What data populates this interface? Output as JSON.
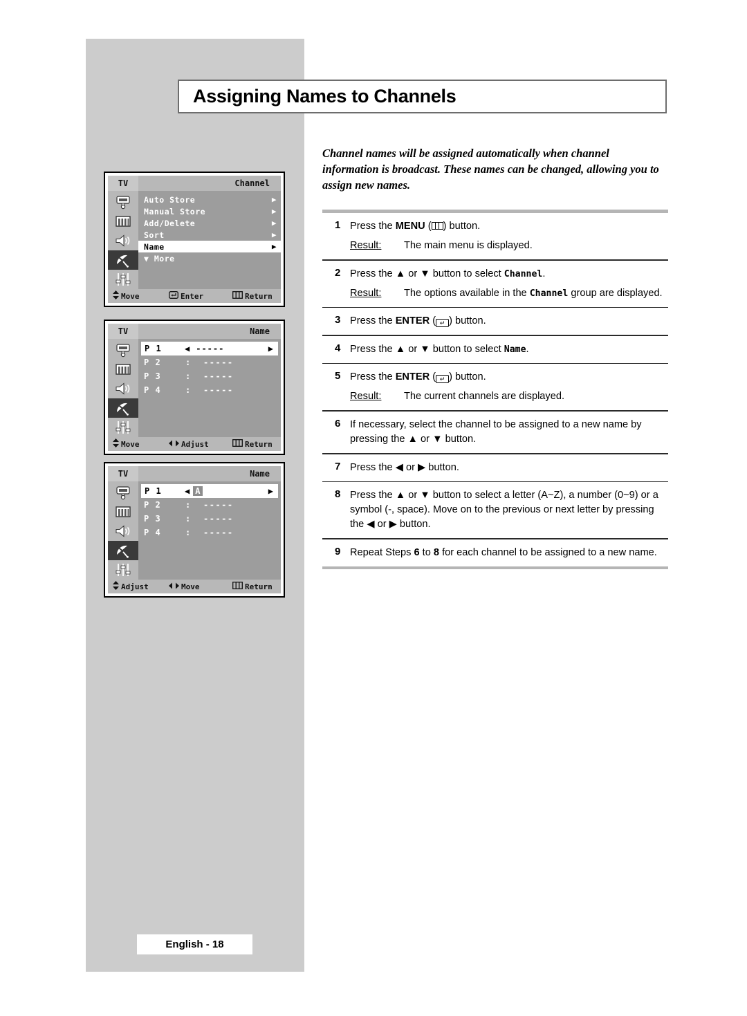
{
  "page": {
    "title": "Assigning Names to Channels",
    "footer_label": "English - 18",
    "intro": "Channel names will be assigned automatically when channel information is broadcast. These names can be changed, allowing you to assign new names."
  },
  "osd_menus": [
    {
      "tv_label": "TV",
      "title": "Channel",
      "rows": [
        {
          "label": "Auto Store",
          "arrow": "▶",
          "highlight": false
        },
        {
          "label": "Manual Store",
          "arrow": "▶",
          "highlight": false
        },
        {
          "label": "Add/Delete",
          "arrow": "▶",
          "highlight": false
        },
        {
          "label": "Sort",
          "arrow": "▶",
          "highlight": false
        },
        {
          "label": "Name",
          "arrow": "▶",
          "highlight": true
        },
        {
          "label": "▼ More",
          "arrow": "",
          "highlight": false
        }
      ],
      "footer": [
        {
          "icon": "updown-arrow-icon",
          "label": "Move"
        },
        {
          "icon": "enter-icon",
          "label": "Enter"
        },
        {
          "icon": "menu-icon",
          "label": "Return"
        }
      ]
    },
    {
      "tv_label": "TV",
      "title": "Name",
      "channels": [
        {
          "p": "P 1",
          "sep": "",
          "value": "-----",
          "highlight": true
        },
        {
          "p": "P 2",
          "sep": ":",
          "value": "-----",
          "highlight": false
        },
        {
          "p": "P 3",
          "sep": ":",
          "value": "-----",
          "highlight": false
        },
        {
          "p": "P 4",
          "sep": ":",
          "value": "-----",
          "highlight": false
        }
      ],
      "footer": [
        {
          "icon": "updown-arrow-icon",
          "label": "Move"
        },
        {
          "icon": "leftright-arrow-icon",
          "label": "Adjust"
        },
        {
          "icon": "menu-icon",
          "label": "Return"
        }
      ]
    },
    {
      "tv_label": "TV",
      "title": "Name",
      "channels": [
        {
          "p": "P 1",
          "sep": "",
          "value": "A",
          "highlight": true
        },
        {
          "p": "P 2",
          "sep": ":",
          "value": "-----",
          "highlight": false
        },
        {
          "p": "P 3",
          "sep": ":",
          "value": "-----",
          "highlight": false
        },
        {
          "p": "P 4",
          "sep": ":",
          "value": "-----",
          "highlight": false
        }
      ],
      "footer": [
        {
          "icon": "updown-arrow-icon",
          "label": "Adjust"
        },
        {
          "icon": "leftright-arrow-icon",
          "label": "Move"
        },
        {
          "icon": "menu-icon",
          "label": "Return"
        }
      ]
    }
  ],
  "rail_icons": [
    "picture-icon",
    "bars-icon",
    "speaker-icon",
    "satellite-dish-icon",
    "sliders-icon"
  ],
  "steps": [
    {
      "num": "1",
      "text_pre": "Press the ",
      "bold": "MENU",
      "icon": "menu-icon",
      "text_post": " button.",
      "result_label": "Result:",
      "result_text": "The main menu is displayed."
    },
    {
      "num": "2",
      "text_pre": "Press the ▲ or ▼ button to select ",
      "mono": "Channel",
      "text_post": ".",
      "result_label": "Result:",
      "result_pre": "The options available in the ",
      "result_mono": "Channel",
      "result_post": " group are displayed."
    },
    {
      "num": "3",
      "text_pre": "Press the ",
      "bold": "ENTER",
      "icon": "enter-icon",
      "text_post": " button."
    },
    {
      "num": "4",
      "text_pre": "Press the ▲ or ▼ button to select ",
      "mono": "Name",
      "text_post": "."
    },
    {
      "num": "5",
      "text_pre": "Press the ",
      "bold": "ENTER",
      "icon": "enter-icon",
      "text_post": " button.",
      "result_label": "Result:",
      "result_text": "The current channels are displayed."
    },
    {
      "num": "6",
      "text": "If necessary, select the channel to be assigned to a new name by pressing the ▲ or ▼ button."
    },
    {
      "num": "7",
      "text": "Press the ◀ or ▶ button."
    },
    {
      "num": "8",
      "text": "Press the ▲ or ▼ button to select a letter (A~Z), a number (0~9) or a symbol (-, space). Move on to the previous or next letter by pressing the ◀ or ▶ button."
    },
    {
      "num": "9",
      "text_pre": "Repeat Steps ",
      "b1": "6",
      "text_mid": " to ",
      "b2": "8",
      "text_post": " for each channel to be assigned to a new name."
    }
  ],
  "colors": {
    "band": "#cccccc",
    "osd_body": "#9d9d9d",
    "osd_bar": "#b8b8b8",
    "highlight": "#ffffff",
    "rule": "#b5b5b5"
  }
}
